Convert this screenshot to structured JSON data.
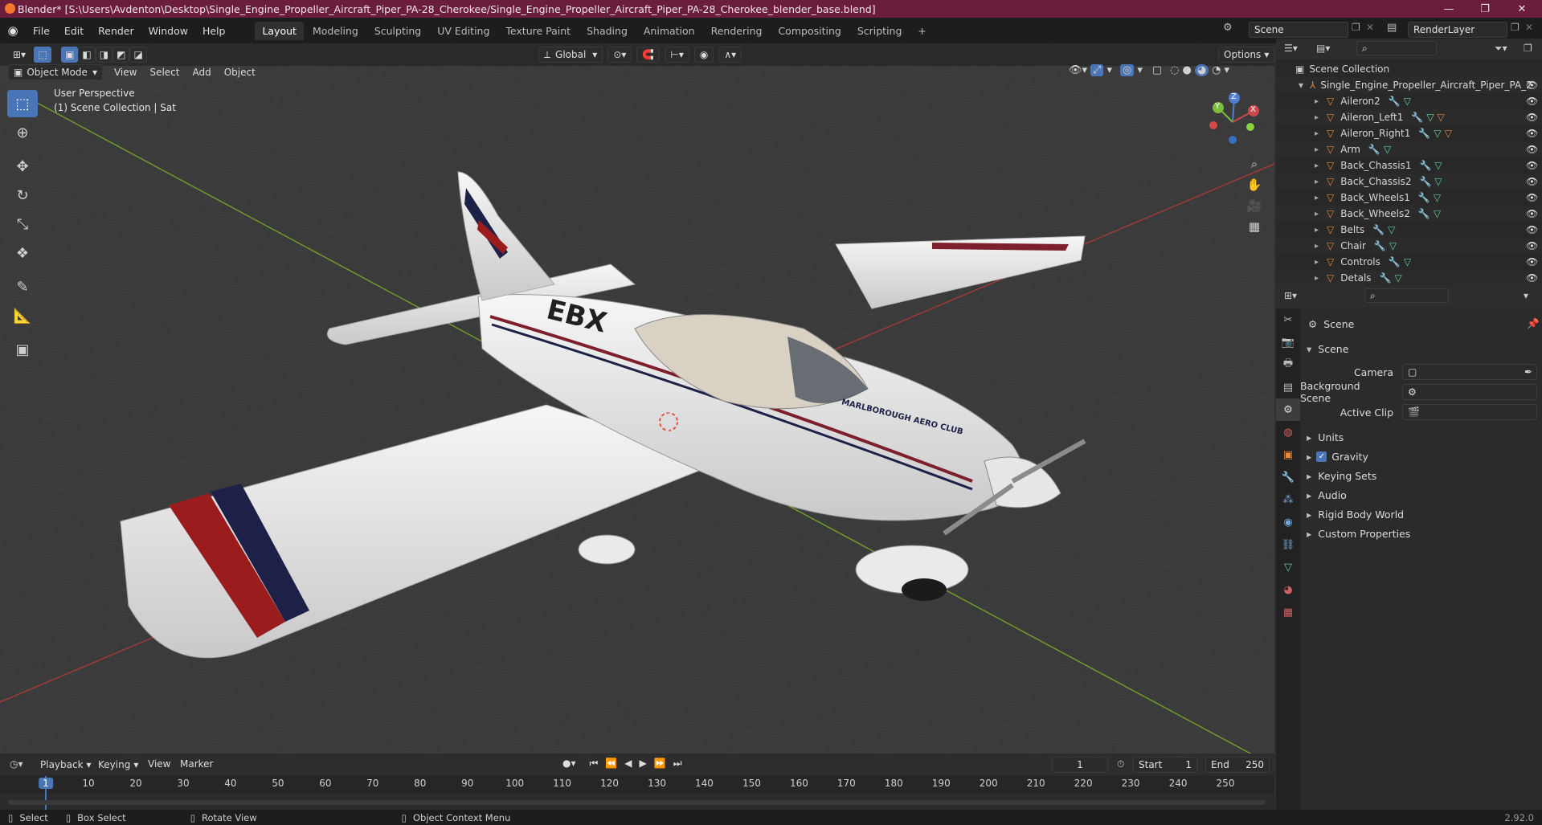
{
  "window": {
    "title": "Blender* [S:\\Users\\Avdenton\\Desktop\\Single_Engine_Propeller_Aircraft_Piper_PA-28_Cherokee/Single_Engine_Propeller_Aircraft_Piper_PA-28_Cherokee_blender_base.blend]",
    "minimize": "—",
    "maximize": "❐",
    "close": "✕"
  },
  "menu": {
    "items": [
      "File",
      "Edit",
      "Render",
      "Window",
      "Help"
    ],
    "workspaces": [
      "Layout",
      "Modeling",
      "Sculpting",
      "UV Editing",
      "Texture Paint",
      "Shading",
      "Animation",
      "Rendering",
      "Compositing",
      "Scripting"
    ],
    "active_workspace": "Layout",
    "add_workspace": "+",
    "scene_value": "Scene",
    "render_layer_value": "RenderLayer"
  },
  "viewport_header": {
    "mode": "Object Mode",
    "menus": [
      "View",
      "Select",
      "Add",
      "Object"
    ],
    "transform_orientation": "Global",
    "options_label": "Options"
  },
  "viewport": {
    "perspective_label": "User Perspective",
    "collection_label": "(1) Scene Collection | Sat",
    "gizmo_axes": [
      "Z",
      "Y",
      "X"
    ],
    "aircraft_registration": "EBX",
    "aircraft_club_text": "MARLBOROUGH AERO CLUB"
  },
  "outliner": {
    "root": "Scene Collection",
    "collection": "Single_Engine_Propeller_Aircraft_Piper_PA_2",
    "objects": [
      "Aileron2",
      "Aileron_Left1",
      "Aileron_Right1",
      "Arm",
      "Back_Chassis1",
      "Back_Chassis2",
      "Back_Wheels1",
      "Back_Wheels2",
      "Belts",
      "Chair",
      "Controls",
      "Detals"
    ]
  },
  "properties": {
    "context_title": "Scene",
    "section_scene": "Scene",
    "fields": [
      {
        "label": "Camera",
        "value": ""
      },
      {
        "label": "Background Scene",
        "value": ""
      },
      {
        "label": "Active Clip",
        "value": ""
      }
    ],
    "subsections": [
      "Units",
      "Gravity",
      "Keying Sets",
      "Audio",
      "Rigid Body World",
      "Custom Properties"
    ],
    "gravity_checked": true
  },
  "timeline": {
    "menus": [
      "Playback",
      "Keying",
      "View",
      "Marker"
    ],
    "current_frame": "1",
    "start_label": "Start",
    "start_value": "1",
    "end_label": "End",
    "end_value": "250",
    "ticks": [
      "1",
      "10",
      "20",
      "30",
      "40",
      "50",
      "60",
      "70",
      "80",
      "90",
      "100",
      "110",
      "120",
      "130",
      "140",
      "150",
      "160",
      "170",
      "180",
      "190",
      "200",
      "210",
      "220",
      "230",
      "240",
      "250"
    ]
  },
  "statusbar": {
    "select": "Select",
    "box_select": "Box Select",
    "rotate_view": "Rotate View",
    "context_menu": "Object Context Menu",
    "version": "2.92.0"
  },
  "colors": {
    "accent_blue": "#4a76b8",
    "title_bar": "#6b1e3c",
    "mesh_icon_orange": "#e8883a",
    "modifier_icon_blue": "#6fa8dc",
    "data_icon_green": "#5fd39a"
  }
}
